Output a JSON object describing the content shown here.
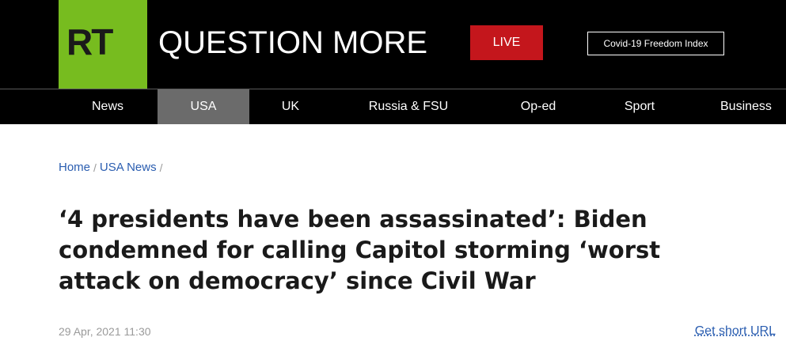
{
  "header": {
    "logo_text": "RT",
    "tagline": "QUESTION MORE",
    "live_label": "LIVE",
    "covid_label": "Covid-19 Freedom Index",
    "brand_color": "#77bc1f",
    "live_color": "#c4161c"
  },
  "nav": {
    "items": [
      {
        "label": "News",
        "active": false
      },
      {
        "label": "USA",
        "active": true
      },
      {
        "label": "UK",
        "active": false
      },
      {
        "label": "Russia & FSU",
        "active": false
      },
      {
        "label": "Op-ed",
        "active": false
      },
      {
        "label": "Sport",
        "active": false
      },
      {
        "label": "Business",
        "active": false
      }
    ]
  },
  "breadcrumb": {
    "home": "Home",
    "section": "USA News"
  },
  "article": {
    "headline": "‘4 presidents have been assassinated’: Biden condemned for calling Capitol storming ‘worst attack on democracy’ since Civil War",
    "date": "29 Apr, 2021 11:30",
    "short_url_label": "Get short URL"
  }
}
